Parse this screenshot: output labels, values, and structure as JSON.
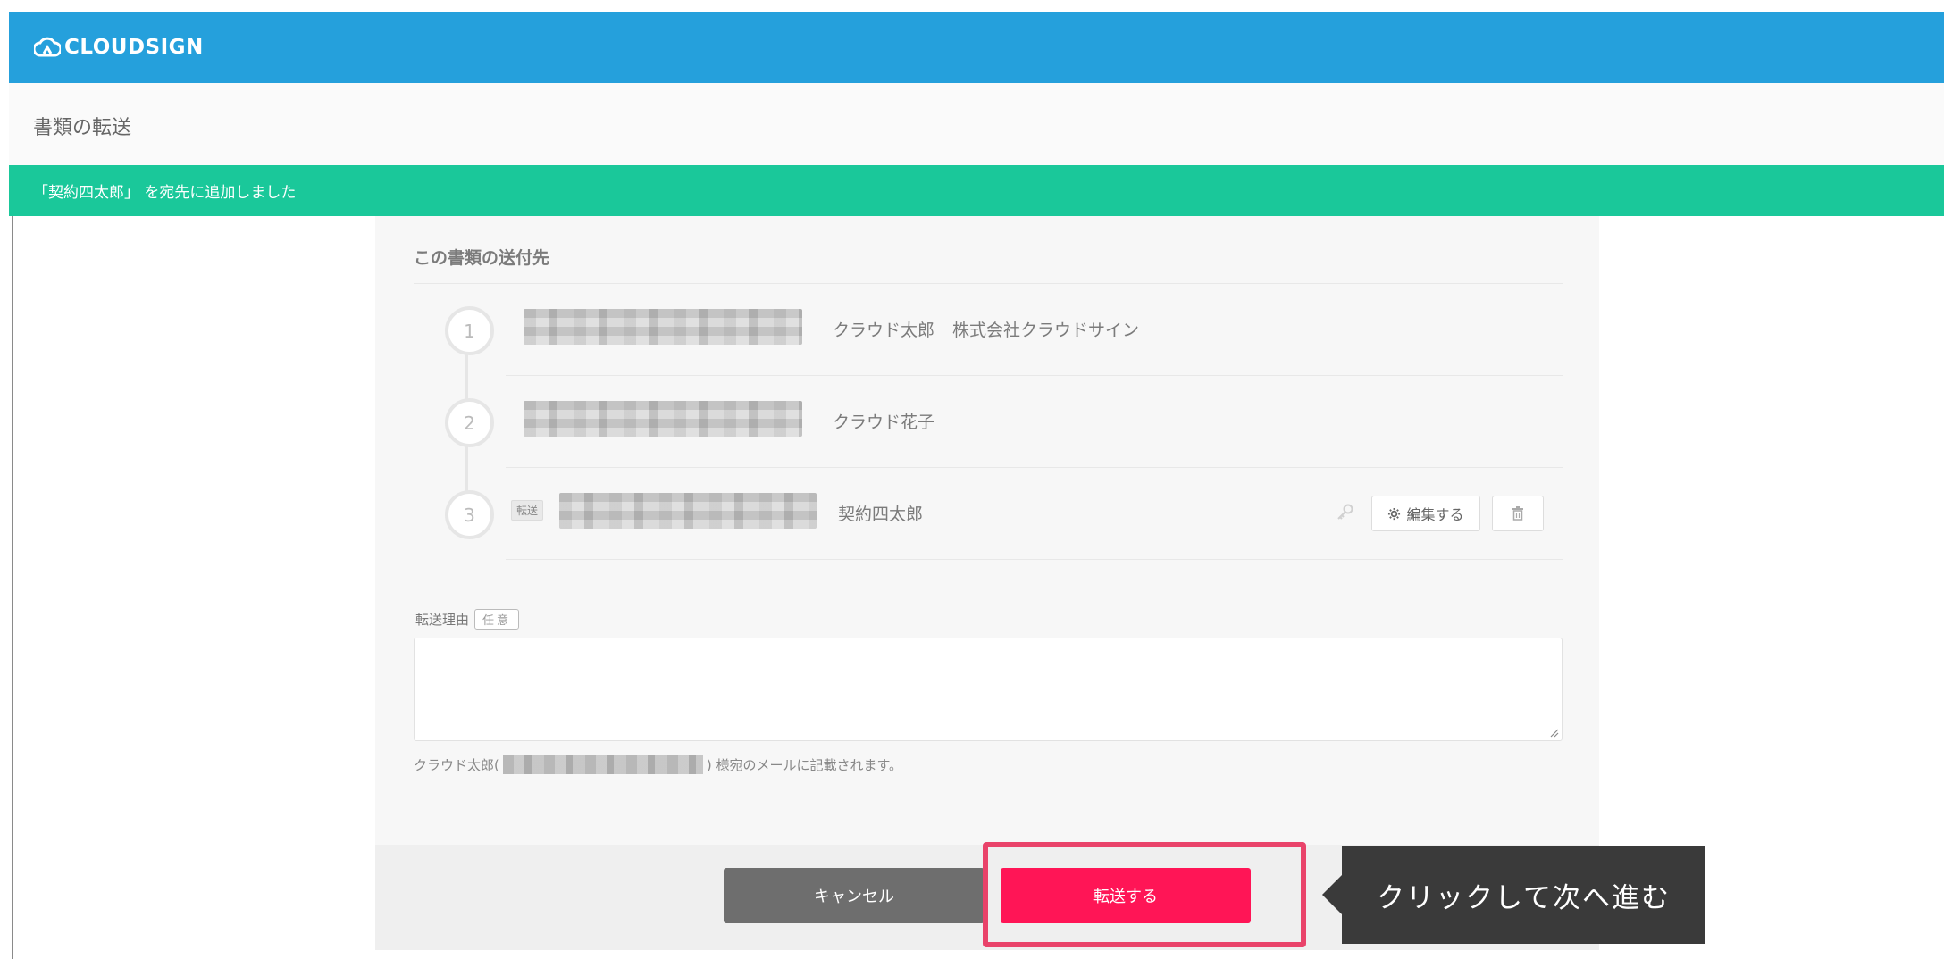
{
  "header": {
    "logo_text": "CLOUDSIGN"
  },
  "page": {
    "title": "書類の転送"
  },
  "notice": {
    "text": "「契約四太郎」 を宛先に追加しました"
  },
  "recipients": {
    "section_title": "この書類の送付先",
    "items": [
      {
        "step": "1",
        "name": "クラウド太郎",
        "company": "株式会社クラウドサイン"
      },
      {
        "step": "2",
        "name": "クラウド花子"
      },
      {
        "step": "3",
        "tag": "転送",
        "name": "契約四太郎",
        "edit_label": "編集する"
      }
    ]
  },
  "reason": {
    "label": "転送理由",
    "optional_badge": "任意",
    "value": "",
    "note_prefix": "クラウド太郎(",
    "note_suffix": ") 様宛のメールに記載されます。"
  },
  "actions": {
    "cancel_label": "キャンセル",
    "forward_label": "転送する"
  },
  "tooltip": {
    "text": "クリックして次へ進む"
  },
  "colors": {
    "brand": "#25a0dc",
    "success": "#1ac89a",
    "primary": "#ff1556",
    "highlight": "#e9436a"
  }
}
